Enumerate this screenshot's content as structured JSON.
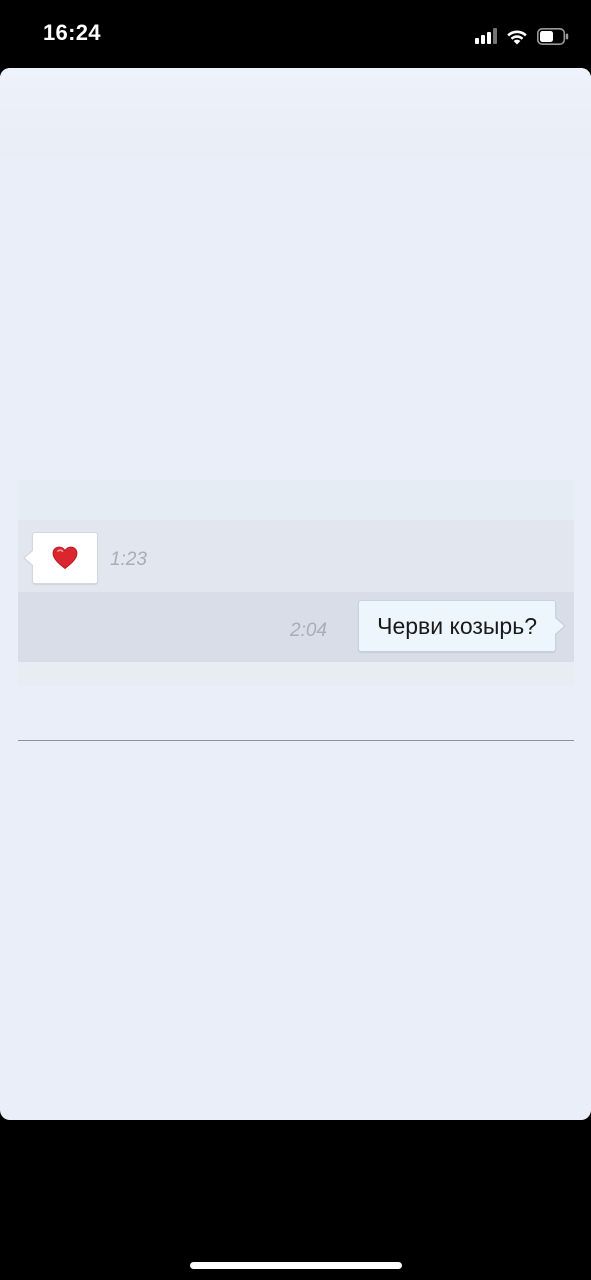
{
  "status_bar": {
    "time": "16:24",
    "icons": [
      "cellular-signal-icon",
      "wifi-icon",
      "battery-icon"
    ]
  },
  "chat": {
    "messages": [
      {
        "direction": "incoming",
        "content_icon": "red-heart-emoji",
        "time": "1:23"
      },
      {
        "direction": "outgoing",
        "text": "Черви козырь?",
        "time": "2:04"
      }
    ]
  },
  "colors": {
    "card_background": "#e9eef8",
    "incoming_row": "#e2e6ef",
    "outgoing_row": "#d8dde7",
    "outgoing_bubble": "#eef6fd",
    "heart": "#d9262f"
  }
}
